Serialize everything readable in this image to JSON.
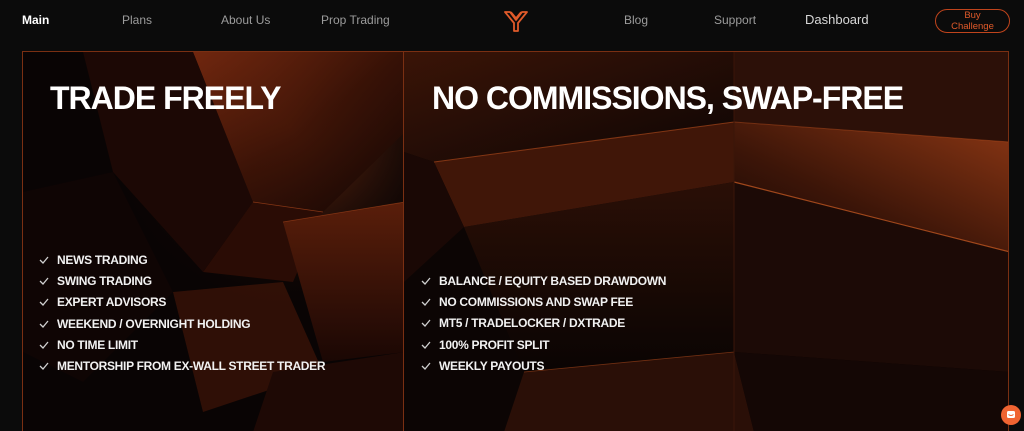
{
  "nav": {
    "items": [
      {
        "label": "Main",
        "active": true
      },
      {
        "label": "Plans"
      },
      {
        "label": "About Us"
      },
      {
        "label": "Prop Trading"
      },
      {
        "label": "Blog"
      },
      {
        "label": "Support"
      },
      {
        "label": "Dashboard"
      }
    ],
    "cta_label": "Buy Challenge",
    "logo_icon": "brand-logo-icon"
  },
  "panels": {
    "left": {
      "title": "TRADE FREELY",
      "features": [
        "NEWS TRADING",
        "SWING TRADING",
        "EXPERT ADVISORS",
        "WEEKEND / OVERNIGHT HOLDING",
        "NO TIME LIMIT",
        "MENTORSHIP FROM EX-WALL STREET TRADER"
      ]
    },
    "right": {
      "title": "NO COMMISSIONS, SWAP-FREE",
      "features": [
        "BALANCE / EQUITY BASED DRAWDOWN",
        "NO COMMISSIONS AND SWAP FEE",
        "MT5 / TRADELOCKER / DXTRADE",
        "100% PROFIT SPLIT",
        "WEEKLY PAYOUTS"
      ]
    }
  },
  "colors": {
    "accent": "#e05a2a",
    "background": "#0b0b0b",
    "panel_border": "#7a2f12"
  },
  "icons": {
    "check": "check-icon",
    "chat": "chat-bubble-icon"
  }
}
